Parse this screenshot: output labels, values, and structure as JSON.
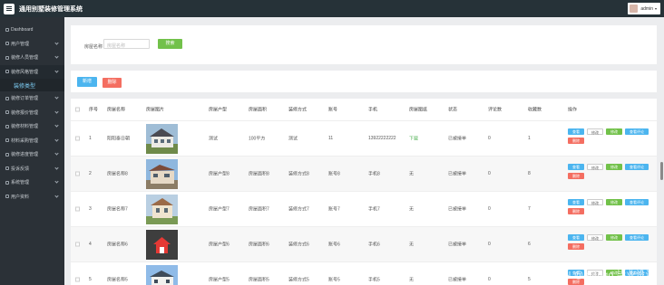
{
  "app": {
    "title": "通用别墅装修管理系统",
    "user": "admin"
  },
  "sidebar": {
    "items": [
      {
        "label": "Dashboard",
        "icon": "home-icon",
        "chevron": false
      },
      {
        "label": "用户管理",
        "icon": "user-icon",
        "chevron": true
      },
      {
        "label": "装修人员管理",
        "icon": "worker-icon",
        "chevron": true
      },
      {
        "label": "装修风格管理",
        "icon": "style-icon",
        "chevron": true
      },
      {
        "label": "装修类型",
        "sub": true
      },
      {
        "label": "装修订单管理",
        "icon": "order-icon",
        "chevron": true
      },
      {
        "label": "装修报价管理",
        "icon": "quote-icon",
        "chevron": true
      },
      {
        "label": "装修材料管理",
        "icon": "material-icon",
        "chevron": true
      },
      {
        "label": "材料采购管理",
        "icon": "purchase-icon",
        "chevron": true
      },
      {
        "label": "装修进度管理",
        "icon": "progress-icon",
        "chevron": true
      },
      {
        "label": "投诉反馈",
        "icon": "feedback-icon",
        "chevron": true
      },
      {
        "label": "系统管理",
        "icon": "settings-icon",
        "chevron": true
      },
      {
        "label": "用户资料",
        "icon": "profile-icon",
        "chevron": true
      }
    ]
  },
  "search": {
    "label": "房屋名称",
    "placeholder": "房屋名称",
    "button": "搜索"
  },
  "actions": {
    "add": "新增",
    "delete": "删除"
  },
  "table": {
    "headers": [
      "序号",
      "房屋名称",
      "房屋图片",
      "房屋户型",
      "房屋面积",
      "装修方式",
      "账号",
      "手机",
      "房屋图纸",
      "状态",
      "评论数",
      "收藏数",
      "操作"
    ],
    "rows": [
      {
        "no": "1",
        "name": "阳阳泰日朝",
        "type": "测试",
        "area": "100平方",
        "method": "测试",
        "account": "11",
        "phone": "13922222222",
        "drawing": "下载",
        "status": "已被接单",
        "comments": "0",
        "favorites": "1",
        "thumb": "villa-a"
      },
      {
        "no": "2",
        "name": "房屋名称8",
        "type": "房屋户型8",
        "area": "房屋面积8",
        "method": "装修方式8",
        "account": "账号8",
        "phone": "手机8",
        "drawing": "无",
        "status": "已被接单",
        "comments": "0",
        "favorites": "8",
        "thumb": "villa-b"
      },
      {
        "no": "3",
        "name": "房屋名称7",
        "type": "房屋户型7",
        "area": "房屋面积7",
        "method": "装修方式7",
        "account": "账号7",
        "phone": "手机7",
        "drawing": "无",
        "status": "已被接单",
        "comments": "0",
        "favorites": "7",
        "thumb": "villa-c"
      },
      {
        "no": "4",
        "name": "房屋名称6",
        "type": "房屋户型6",
        "area": "房屋面积6",
        "method": "装修方式6",
        "account": "账号6",
        "phone": "手机6",
        "drawing": "无",
        "status": "已被接单",
        "comments": "0",
        "favorites": "6",
        "thumb": "house-icon"
      },
      {
        "no": "5",
        "name": "房屋名称5",
        "type": "房屋户型5",
        "area": "房屋面积5",
        "method": "装修方式5",
        "account": "账号5",
        "phone": "手机5",
        "drawing": "无",
        "status": "已被接单",
        "comments": "0",
        "favorites": "5",
        "thumb": "villa-d"
      }
    ],
    "op_labels": {
      "view": "查看",
      "edit": "修改",
      "comment": "修改",
      "review": "查看评论",
      "delete": "删除"
    }
  },
  "watermark": "CSDN @django 毕业设计",
  "colors": {
    "topbar": "#263238",
    "sidebar": "#2b3137",
    "primary": "#4cb5ef",
    "success": "#72c14a",
    "danger": "#f46e61",
    "active": "#7fd0f8",
    "link": "#4caf50"
  }
}
